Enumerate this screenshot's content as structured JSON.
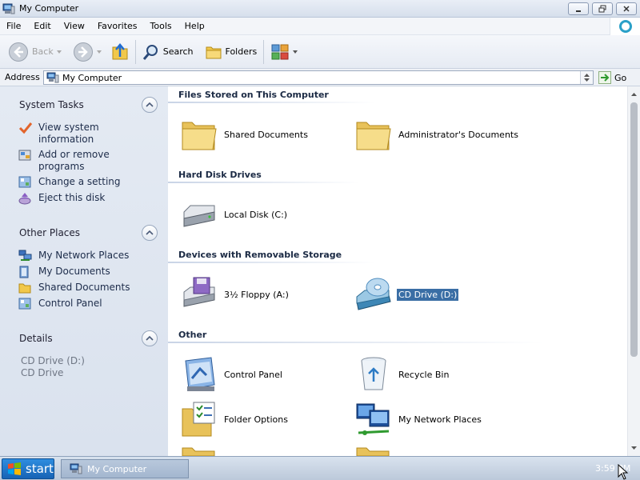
{
  "window": {
    "title": "My Computer"
  },
  "menubar": {
    "items": [
      "File",
      "Edit",
      "View",
      "Favorites",
      "Tools",
      "Help"
    ]
  },
  "toolbar": {
    "back_label": "Back",
    "search_label": "Search",
    "folders_label": "Folders"
  },
  "address": {
    "label": "Address",
    "value": "My Computer",
    "go_label": "Go"
  },
  "left_pane": {
    "system_tasks": {
      "title": "System Tasks",
      "items": [
        {
          "label": "View system information",
          "icon": "checkmark-icon"
        },
        {
          "label": "Add or remove programs",
          "icon": "add-remove-programs-icon"
        },
        {
          "label": "Change a setting",
          "icon": "control-panel-setting-icon"
        },
        {
          "label": "Eject this disk",
          "icon": "eject-disk-icon"
        }
      ]
    },
    "other_places": {
      "title": "Other Places",
      "items": [
        {
          "label": "My Network Places",
          "icon": "network-places-icon"
        },
        {
          "label": "My Documents",
          "icon": "my-documents-icon"
        },
        {
          "label": "Shared Documents",
          "icon": "shared-documents-icon"
        },
        {
          "label": "Control Panel",
          "icon": "control-panel-icon"
        }
      ]
    },
    "details": {
      "title": "Details",
      "lines": [
        "CD Drive (D:)",
        "CD Drive"
      ]
    }
  },
  "main": {
    "sections": [
      {
        "title": "Files Stored on This Computer",
        "items": [
          {
            "label": "Shared Documents",
            "icon": "folder-icon"
          },
          {
            "label": "Administrator's Documents",
            "icon": "folder-icon"
          }
        ]
      },
      {
        "title": "Hard Disk Drives",
        "items": [
          {
            "label": "Local Disk (C:)",
            "icon": "hard-disk-icon"
          }
        ]
      },
      {
        "title": "Devices with Removable Storage",
        "items": [
          {
            "label": "3½ Floppy (A:)",
            "icon": "floppy-drive-icon"
          },
          {
            "label": "CD Drive (D:)",
            "icon": "cd-drive-icon",
            "selected": true
          }
        ]
      },
      {
        "title": "Other",
        "items": [
          {
            "label": "Control Panel",
            "icon": "control-panel-icon"
          },
          {
            "label": "Recycle Bin",
            "icon": "recycle-bin-icon"
          },
          {
            "label": "Folder Options",
            "icon": "folder-options-icon"
          },
          {
            "label": "My Network Places",
            "icon": "network-places-icon"
          }
        ]
      }
    ]
  },
  "taskbar": {
    "start_label": "start",
    "task_label": "My Computer",
    "clock": "3:59 PM"
  },
  "colors": {
    "selection": "#3a6ea5",
    "left_pane_bg": "#dfe6f0",
    "start_button": "#1f78cf"
  }
}
